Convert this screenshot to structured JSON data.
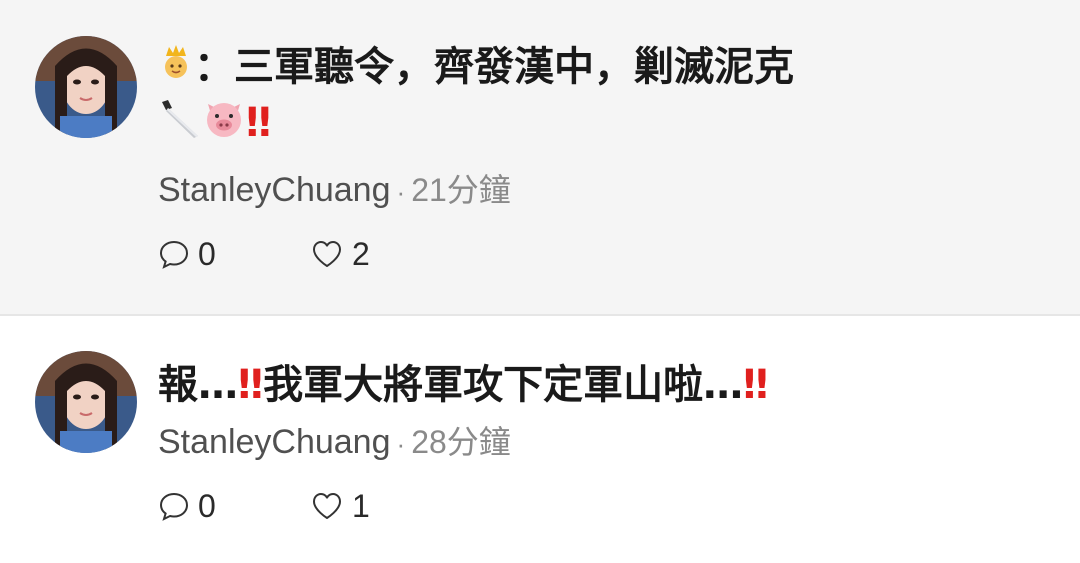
{
  "posts": [
    {
      "text_main": "：三軍聽令，齊發漢中，剿滅泥克",
      "lead_emoji": "crown-person-emoji",
      "trail_emojis": [
        "knife-emoji",
        "pig-face-emoji"
      ],
      "bangs": "‼",
      "author": "StanleyChuang",
      "separator": "·",
      "time": "21分鐘",
      "comments": "0",
      "likes": "2"
    },
    {
      "text_a": "報…",
      "bangs_a": "‼",
      "text_b": "我軍大將軍攻下定軍山啦…",
      "bangs_b": "‼",
      "author": "StanleyChuang",
      "separator": "·",
      "time": "28分鐘",
      "comments": "0",
      "likes": "1"
    }
  ],
  "colors": {
    "highlight_bg": "#f5f5f5",
    "bangs": "#e0201e",
    "meta_gray": "#8a8a8a"
  },
  "icons": {
    "comment": "speech-bubble-icon",
    "like": "heart-outline-icon"
  }
}
